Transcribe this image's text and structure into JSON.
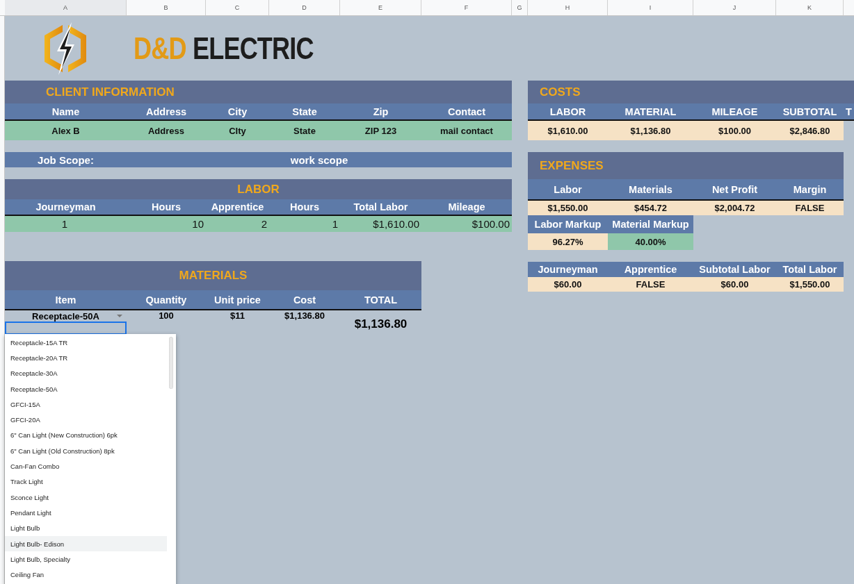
{
  "column_headers": [
    "A",
    "B",
    "C",
    "D",
    "E",
    "F",
    "G",
    "H",
    "I",
    "J",
    "K"
  ],
  "brand": {
    "accent": "D&D",
    "name": "ELECTRIC"
  },
  "client_information": {
    "title": "CLIENT INFORMATION",
    "columns": [
      "Name",
      "Address",
      "City",
      "State",
      "Zip",
      "Contact"
    ],
    "row": [
      "Alex B",
      "Address",
      "CIty",
      "State",
      "ZIP 123",
      "mail contact"
    ]
  },
  "job_scope": {
    "label": "Job Scope:",
    "value": "work scope"
  },
  "labor": {
    "title": "LABOR",
    "columns": [
      "Journeyman",
      "Hours",
      "Apprentice",
      "Hours",
      "Total Labor",
      "Mileage"
    ],
    "row": [
      "1",
      "10",
      "2",
      "1",
      "$1,610.00",
      "$100.00"
    ]
  },
  "materials": {
    "title": "MATERIALS",
    "columns": [
      "Item",
      "Quantity",
      "Unit price",
      "Cost",
      "TOTAL"
    ],
    "rows": [
      {
        "item": "Receptacle-50A",
        "quantity": "100",
        "unit_price": "$11",
        "cost": "$1,136.80",
        "selected": false
      },
      {
        "selected": true
      }
    ],
    "total": "$1,136.80"
  },
  "item_dropdown": {
    "options": [
      {
        "label": "Receptacle-15A TR",
        "highlighted": false
      },
      {
        "label": "Receptacle-20A TR",
        "highlighted": false
      },
      {
        "label": "Receptacle-30A",
        "highlighted": false
      },
      {
        "label": "Receptacle-50A",
        "highlighted": false
      },
      {
        "label": "GFCI-15A",
        "highlighted": false
      },
      {
        "label": "GFCI-20A",
        "highlighted": false
      },
      {
        "label": "6\" Can Light (New Construction) 6pk",
        "highlighted": false
      },
      {
        "label": "6\" Can Light (Old Construction) 8pk",
        "highlighted": false
      },
      {
        "label": "Can-Fan Combo",
        "highlighted": false
      },
      {
        "label": "Track Light",
        "highlighted": false
      },
      {
        "label": "Sconce Light",
        "highlighted": false
      },
      {
        "label": "Pendant Light",
        "highlighted": false
      },
      {
        "label": "Light Bulb",
        "highlighted": false
      },
      {
        "label": "Light Bulb- Edison",
        "highlighted": true
      },
      {
        "label": "Light Bulb, Specialty",
        "highlighted": false
      },
      {
        "label": "Ceiling Fan",
        "highlighted": false
      }
    ]
  },
  "costs": {
    "title": "COSTS",
    "columns": [
      "LABOR",
      "MATERIAL",
      "MILEAGE",
      "SUBTOTAL",
      "T"
    ],
    "row": [
      "$1,610.00",
      "$1,136.80",
      "$100.00",
      "$2,846.80"
    ]
  },
  "expenses": {
    "title": "EXPENSES",
    "columns": [
      "Labor",
      "Materials",
      "Net Profit",
      "Margin"
    ],
    "row": [
      "$1,550.00",
      "$454.72",
      "$2,004.72",
      "FALSE"
    ],
    "markup_columns": [
      "Labor Markup",
      "Material Markup"
    ],
    "markup_values": [
      {
        "value": "96.27%",
        "color": "#f6e2c5"
      },
      {
        "value": "40.00%",
        "color": "#8fc7aa"
      }
    ]
  },
  "labor_rates": {
    "columns": [
      "Journeyman",
      "Apprentice",
      "Subtotal Labor",
      "Total Labor"
    ],
    "row": [
      "$60.00",
      "FALSE",
      "$60.00",
      "$1,550.00"
    ]
  }
}
